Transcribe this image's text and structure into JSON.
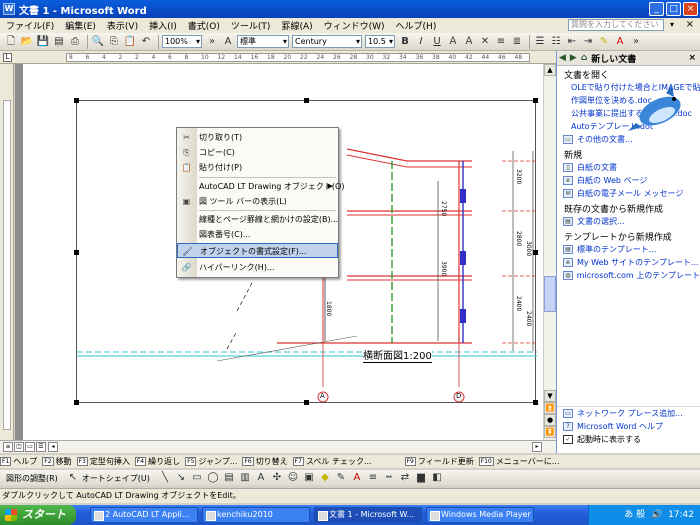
{
  "window": {
    "title": "文書 1 - Microsoft Word",
    "app_icon": "W",
    "buttons": [
      "_",
      "□",
      "×"
    ]
  },
  "menubar": {
    "items": [
      "ファイル(F)",
      "編集(E)",
      "表示(V)",
      "挿入(I)",
      "書式(O)",
      "ツール(T)",
      "罫線(A)",
      "ウィンドウ(W)",
      "ヘルプ(H)"
    ],
    "help_placeholder": "質問を入力してください",
    "doc_close": "×"
  },
  "toolbar": {
    "zoom": "100%",
    "style": "標準",
    "font": "Century",
    "size": "10.5",
    "bold": "B",
    "italic": "I",
    "underline": "U"
  },
  "ruler": {
    "ticks": [
      "8",
      "6",
      "4",
      "2",
      "2",
      "4",
      "6",
      "8",
      "10",
      "12",
      "14",
      "16",
      "18",
      "20",
      "22",
      "24",
      "26",
      "28",
      "30",
      "32",
      "34",
      "36",
      "38",
      "40",
      "42",
      "44",
      "46",
      "48"
    ],
    "corner": "L"
  },
  "document": {
    "caption": "横断面図1:200",
    "label_a": "A",
    "label_d": "D",
    "dims": [
      "3200",
      "2800",
      "2400",
      "3000",
      "1800",
      "2750",
      "3900",
      "2400"
    ]
  },
  "context_menu": {
    "items": [
      {
        "label": "切り取り(T)",
        "icon": "✂"
      },
      {
        "label": "コピー(C)",
        "icon": "⎘"
      },
      {
        "label": "貼り付け(P)",
        "icon": "📋"
      },
      {
        "label": "AutoCAD LT Drawing オブジェクト(O)",
        "submenu": "▶"
      },
      {
        "label": "図 ツール バーの表示(L)",
        "icon": "▣"
      },
      {
        "label": "線種とページ罫線と網かけの設定(B)...",
        "icon": ""
      },
      {
        "label": "図表番号(C)...",
        "icon": ""
      },
      {
        "label": "オブジェクトの書式設定(F)...",
        "icon": "🖌"
      },
      {
        "label": "ハイパーリンク(H)...",
        "icon": "🔗"
      }
    ]
  },
  "taskpane": {
    "title": "新しい文書",
    "open_section": "文書を開く",
    "recent": [
      "OLEで貼り付けた場合とIMAGEで貼",
      "作図単位を決める.doc",
      "公共事業に提出する文書の方.doc",
      "Autoテンプレート.dot"
    ],
    "more_docs": "その他の文書...",
    "new_section": "新規",
    "new_items": [
      "白紙の文書",
      "白紙の Web ページ",
      "白紙の電子メール メッセージ"
    ],
    "existing_section": "既存の文書から新規作成",
    "existing_items": [
      "文書の選択..."
    ],
    "template_section": "テンプレートから新規作成",
    "template_items": [
      "標準のテンプレート...",
      "My Web サイトのテンプレート...",
      "microsoft.com 上のテンプレート"
    ],
    "bottom_items": [
      "ネットワーク プレース追加...",
      "Microsoft Word ヘルプ"
    ],
    "startup_checkbox": "起動時に表示する"
  },
  "fkeys": [
    {
      "key": "F1",
      "label": "ヘルプ"
    },
    {
      "key": "F2",
      "label": "移動"
    },
    {
      "key": "F3",
      "label": "定型句挿入"
    },
    {
      "key": "F4",
      "label": "繰り返し"
    },
    {
      "key": "F5",
      "label": "ジャンプ..."
    },
    {
      "key": "F6",
      "label": "切り替え"
    },
    {
      "key": "F7",
      "label": "スペル チェック..."
    },
    {
      "key": "F9",
      "label": "フィールド更新"
    },
    {
      "key": "F10",
      "label": "メニューバーに..."
    }
  ],
  "drawbar": {
    "adjust": "図形の調整(R)",
    "autoshape": "オートシェイプ(U)"
  },
  "statusbar": {
    "text": "ダブルクリックして AutoCAD LT Drawing オブジェクトをEdit。"
  },
  "taskbar": {
    "start": "スタート",
    "tasks": [
      "2 AutoCAD LT Appli...",
      "kenchiku2010",
      "文書 1 - Microsoft W...",
      "Windows Media Player"
    ],
    "active_task": 2,
    "time": "17:42",
    "ime": "あ 般"
  },
  "colors": {
    "title_bar": "#0741b8",
    "highlight": "#c1d2ee",
    "link": "#0033cc"
  }
}
